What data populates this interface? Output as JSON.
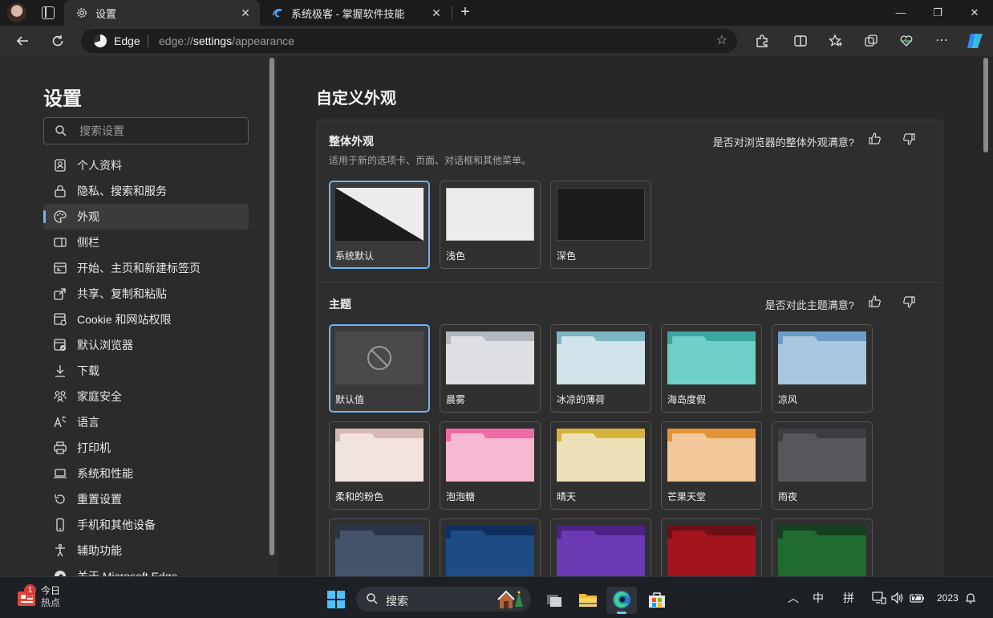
{
  "tabs": [
    {
      "title": "设置",
      "icon": "gear-icon",
      "active": true
    },
    {
      "title": "系统极客 - 掌握软件技能",
      "icon": "site-favicon-icon",
      "active": false
    }
  ],
  "address": {
    "site_name": "Edge",
    "url_prefix": "edge://",
    "url_highlight": "settings",
    "url_suffix": "/appearance"
  },
  "sidebar": {
    "title": "设置",
    "search_placeholder": "搜索设置",
    "items": [
      {
        "label": "个人资料",
        "icon": "profile-icon"
      },
      {
        "label": "隐私、搜索和服务",
        "icon": "lock-icon"
      },
      {
        "label": "外观",
        "icon": "palette-icon",
        "active": true
      },
      {
        "label": "侧栏",
        "icon": "sidebar-icon"
      },
      {
        "label": "开始、主页和新建标签页",
        "icon": "home-icon"
      },
      {
        "label": "共享、复制和粘贴",
        "icon": "share-icon"
      },
      {
        "label": "Cookie 和网站权限",
        "icon": "site-permissions-icon"
      },
      {
        "label": "默认浏览器",
        "icon": "browser-icon"
      },
      {
        "label": "下载",
        "icon": "download-icon"
      },
      {
        "label": "家庭安全",
        "icon": "family-icon"
      },
      {
        "label": "语言",
        "icon": "language-icon"
      },
      {
        "label": "打印机",
        "icon": "printer-icon"
      },
      {
        "label": "系统和性能",
        "icon": "laptop-icon"
      },
      {
        "label": "重置设置",
        "icon": "reset-icon"
      },
      {
        "label": "手机和其他设备",
        "icon": "phone-icon"
      },
      {
        "label": "辅助功能",
        "icon": "accessibility-icon"
      },
      {
        "label": "关于 Microsoft Edge",
        "icon": "edge-icon"
      }
    ]
  },
  "main": {
    "title": "自定义外观",
    "overall": {
      "heading": "整体外观",
      "description": "适用于新的选项卡、页面、对话框和其他菜单。",
      "feedback": "是否对浏览器的整体外观满意?",
      "options": [
        {
          "label": "系统默认",
          "style": "system",
          "selected": true
        },
        {
          "label": "浅色",
          "style": "light",
          "selected": false
        },
        {
          "label": "深色",
          "style": "dark",
          "selected": false
        }
      ]
    },
    "themes": {
      "heading": "主题",
      "feedback": "是否对此主题满意?",
      "items": [
        {
          "label": "默认值",
          "selected": true,
          "tab": "",
          "body": ""
        },
        {
          "label": "晨雾",
          "tab": "#b4b8c0",
          "body": "#dddfe3"
        },
        {
          "label": "冰凉的薄荷",
          "tab": "#7fb5c3",
          "body": "#cfe3e8"
        },
        {
          "label": "海岛度假",
          "tab": "#3aa8a0",
          "body": "#6fcfc9"
        },
        {
          "label": "凉风",
          "tab": "#6e9cc8",
          "body": "#aac6de"
        },
        {
          "label": "柔和的粉色",
          "tab": "#d8b8b4",
          "body": "#f2e2e0"
        },
        {
          "label": "泡泡糖",
          "tab": "#f06aa6",
          "body": "#f7b8d3"
        },
        {
          "label": "晴天",
          "tab": "#d8b33a",
          "body": "#ece0b8"
        },
        {
          "label": "芒果天堂",
          "tab": "#e59435",
          "body": "#f2c89a"
        },
        {
          "label": "雨夜",
          "tab": "#3c3d42",
          "body": "#56575c"
        },
        {
          "label": "",
          "tab": "#2a3548",
          "body": "#44536a"
        },
        {
          "label": "",
          "tab": "#0f2f5c",
          "body": "#1d4c85"
        },
        {
          "label": "",
          "tab": "#4b2382",
          "body": "#6c39b5"
        },
        {
          "label": "",
          "tab": "#6b1016",
          "body": "#a3141d"
        },
        {
          "label": "",
          "tab": "#14401f",
          "body": "#216b30"
        }
      ]
    }
  },
  "taskbar": {
    "news_title": "今日",
    "news_sub": "热点",
    "news_badge": "1",
    "search_label": "搜索",
    "ime_mode": "中",
    "ime_input": "拼",
    "clock": "2023"
  },
  "colors": {
    "accent": "#6fb4f5",
    "taskbar_indicator": "#60cdff"
  }
}
